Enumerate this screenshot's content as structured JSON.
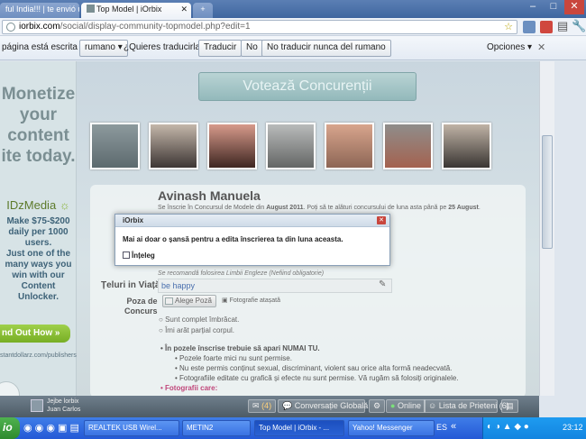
{
  "browser": {
    "tabs": [
      {
        "label": "ful India!!! | te envió u",
        "active": false
      },
      {
        "label": "Top Model | iOrbix",
        "active": true
      }
    ],
    "new_tab_label": "+",
    "url_prefix": "iorbix.com",
    "url_rest": "/social/display-community-topmodel.php?edit=1"
  },
  "translate_bar": {
    "lead": "página está escrita en",
    "language": "rumano",
    "question": "¿Quieres traducirla?",
    "translate_button": "Traducir",
    "no_button": "No",
    "never_button": "No traducir nunca del rumano",
    "options": "Opciones",
    "close": "✕"
  },
  "ad": {
    "line1": "Monetize",
    "line2": "your",
    "line3": "content",
    "line4": "ite today.",
    "brand": "IDzMedia",
    "body1": "Make $75-$200",
    "body2": "daily per 1000",
    "body3": "users.",
    "body4": "Just one of the",
    "body5": "many ways you",
    "body6": "win with our",
    "body7": "Content",
    "body8": "Unlocker.",
    "cta": "nd Out How »",
    "footer": "stantdollarz.com/publishers"
  },
  "vote_button": "Votează Concurenții",
  "profile": {
    "name": "Avinash Manuela",
    "info_text": "Se înscrie în Concursul de Modele din",
    "info_month": "August 2011",
    "info_text2": ". Poți să te alături concursului de luna asta până pe",
    "info_date": "25 August",
    "recommend": "Se recomandă folosirea Limbii Engleze (Nefiind obligatorie)",
    "goals_label": "Țeluri in Viață",
    "goals_value": "be happy",
    "photo_label1": "Poza de",
    "photo_label2": "Concurs",
    "choose_photo": "Alege Poză",
    "attached": "Fotografie atașată",
    "radio1": "Sunt complet îmbrăcat.",
    "radio2": "Îmi arăt parțial corpul.",
    "rule_title": "În pozele înscrise trebuie să apari NUMAI TU.",
    "rule1": "Pozele foarte mici nu sunt permise.",
    "rule2": "Nu este permis conținut sexual, discriminant, violent sau orice alta formă neadecvată.",
    "rule3": "Fotografiile editate cu grafică și efecte nu sunt permise. Vă rugăm să folosiți originalele.",
    "rule4": "Fotografii care:"
  },
  "dialog": {
    "title": "iOrbix",
    "message": "Mai ai doar o șansă pentru a edita înscrierea ta din luna aceasta.",
    "checkbox_label": "Înțeleg"
  },
  "community_bar": {
    "user_line1": "Jejbe lorbix",
    "user_line2": "Juan Carlos",
    "messages_count": "(4)",
    "chat_label": "Conversație Globală",
    "online_label": "Online",
    "friends_label": "Lista de Prieteni (6)"
  },
  "taskbar": {
    "start": "io",
    "items": [
      {
        "label": "REALTEK USB Wirel..."
      },
      {
        "label": "METIN2"
      },
      {
        "label": "Top Model | iOrbix - ..."
      },
      {
        "label": "Yahoo! Messenger"
      }
    ],
    "lang": "ES",
    "clock": "23:12"
  }
}
